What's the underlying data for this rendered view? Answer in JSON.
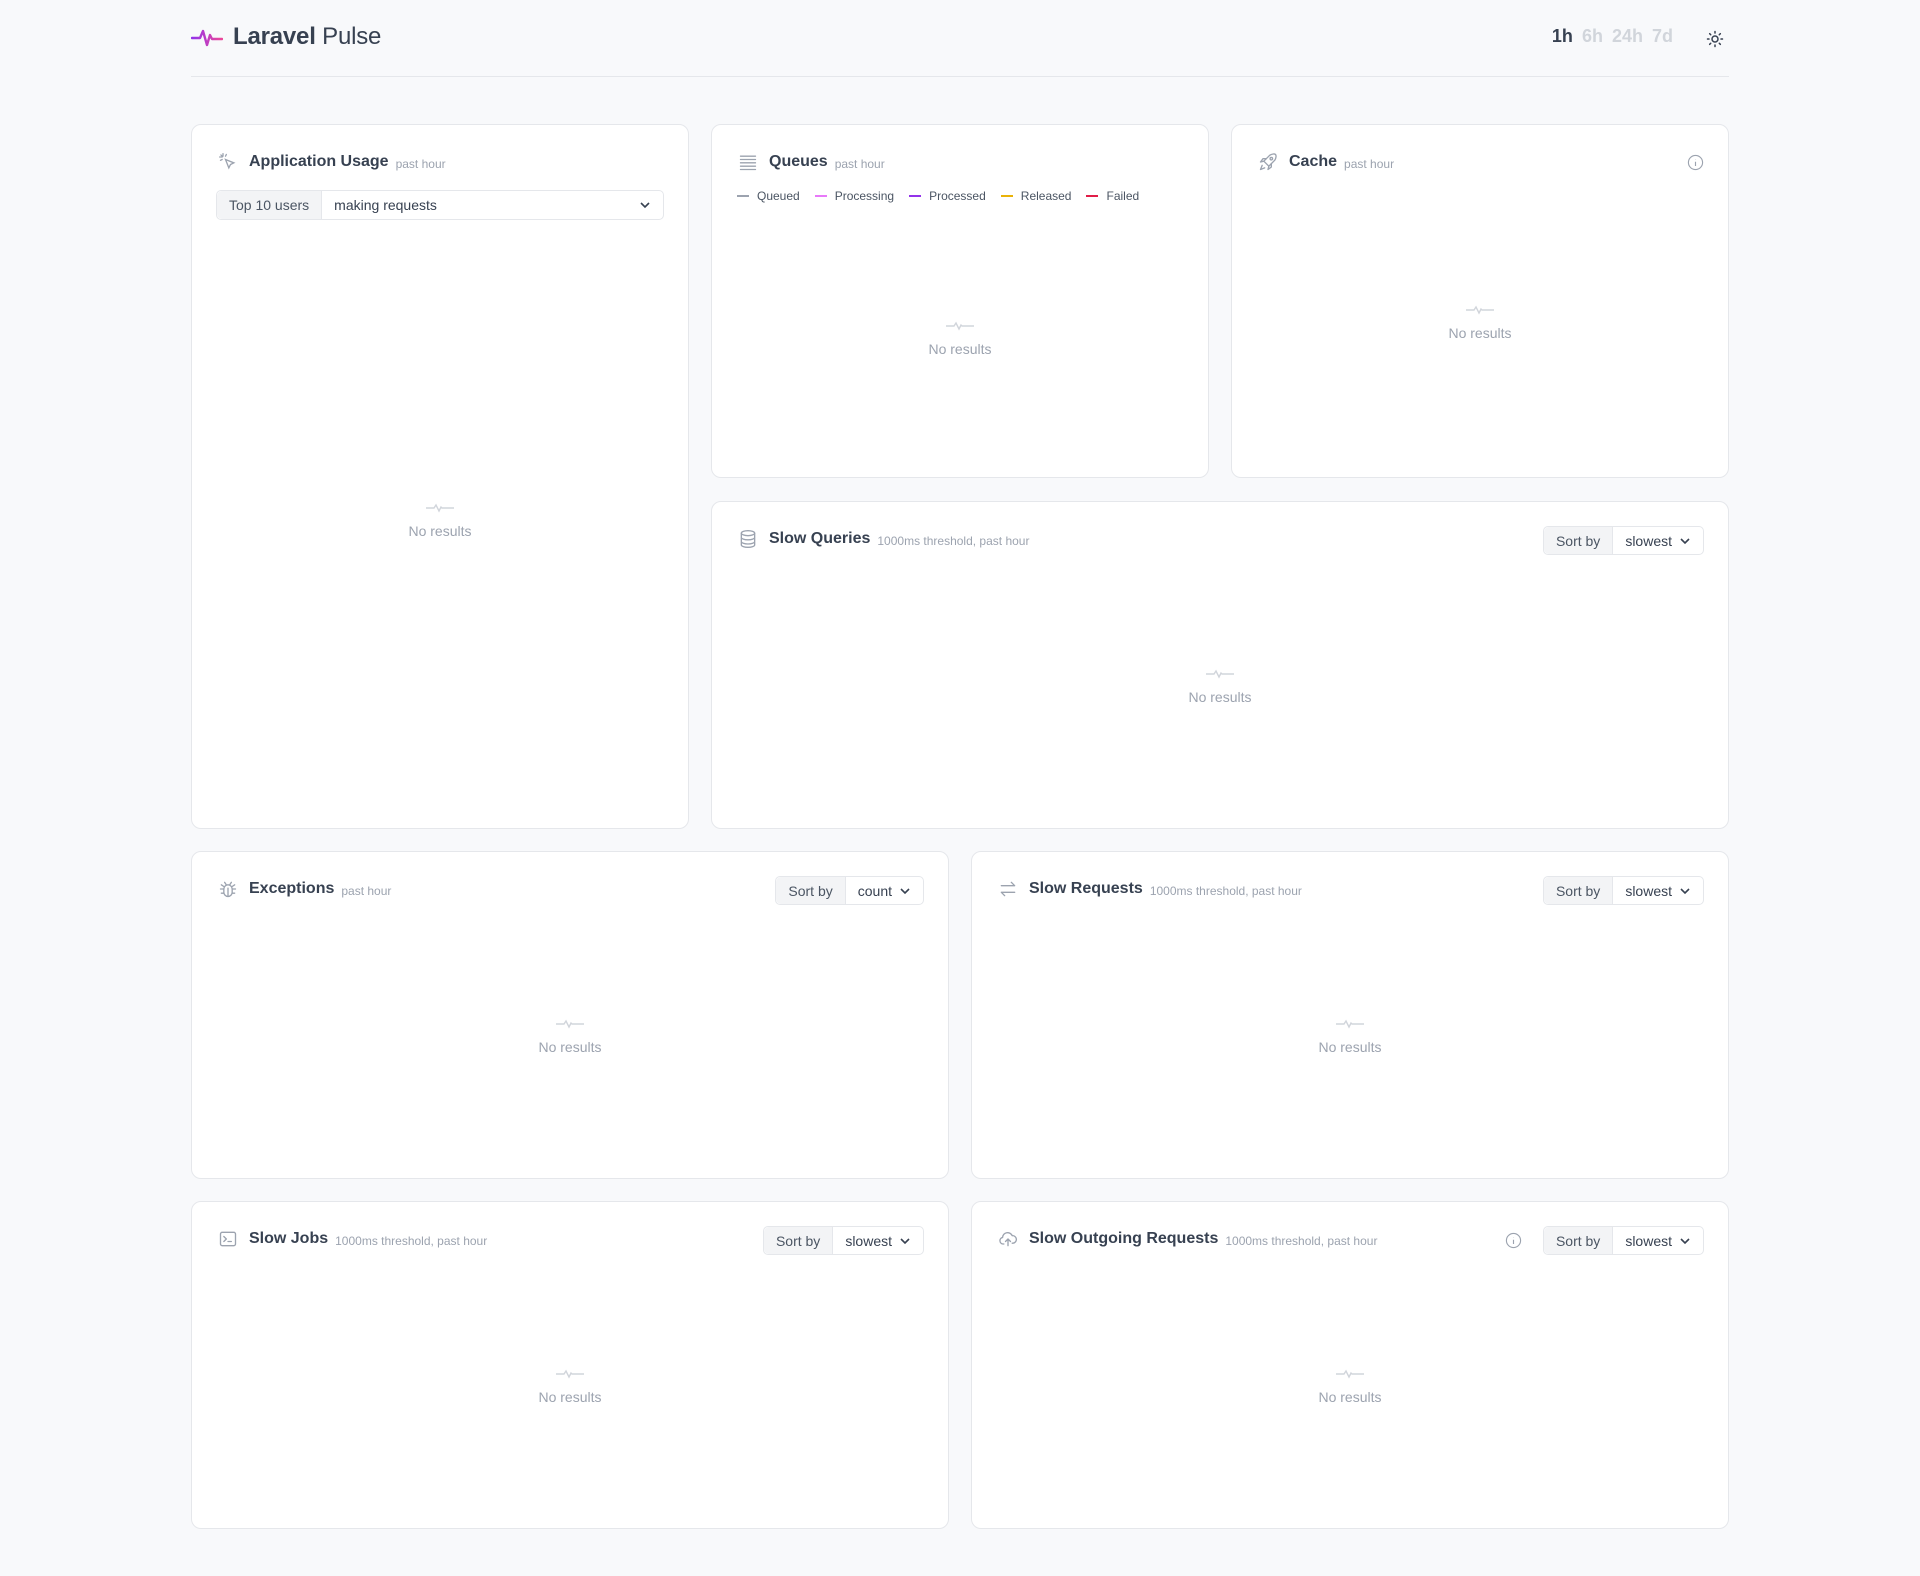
{
  "header": {
    "brand_primary": "Laravel",
    "brand_secondary": "Pulse",
    "periods": [
      "1h",
      "6h",
      "24h",
      "7d"
    ],
    "active_period": "1h"
  },
  "empty_text": "No results",
  "cards": {
    "application_usage": {
      "title": "Application Usage",
      "subtitle": "past hour",
      "select_label": "Top 10 users",
      "select_value": "making requests"
    },
    "queues": {
      "title": "Queues",
      "subtitle": "past hour",
      "legend": [
        {
          "label": "Queued",
          "color": "#9ca3af"
        },
        {
          "label": "Processing",
          "color": "#e879f9"
        },
        {
          "label": "Processed",
          "color": "#9333ea"
        },
        {
          "label": "Released",
          "color": "#eab308"
        },
        {
          "label": "Failed",
          "color": "#e11d48"
        }
      ]
    },
    "cache": {
      "title": "Cache",
      "subtitle": "past hour"
    },
    "slow_queries": {
      "title": "Slow Queries",
      "subtitle": "1000ms threshold, past hour",
      "sort_label": "Sort by",
      "sort_value": "slowest"
    },
    "exceptions": {
      "title": "Exceptions",
      "subtitle": "past hour",
      "sort_label": "Sort by",
      "sort_value": "count"
    },
    "slow_requests": {
      "title": "Slow Requests",
      "subtitle": "1000ms threshold, past hour",
      "sort_label": "Sort by",
      "sort_value": "slowest"
    },
    "slow_jobs": {
      "title": "Slow Jobs",
      "subtitle": "1000ms threshold, past hour",
      "sort_label": "Sort by",
      "sort_value": "slowest"
    },
    "slow_outgoing_requests": {
      "title": "Slow Outgoing Requests",
      "subtitle": "1000ms threshold, past hour",
      "sort_label": "Sort by",
      "sort_value": "slowest"
    }
  },
  "colors": {
    "accent_start": "#a855f7",
    "accent_end": "#ec4899",
    "muted": "#9ca3af"
  }
}
